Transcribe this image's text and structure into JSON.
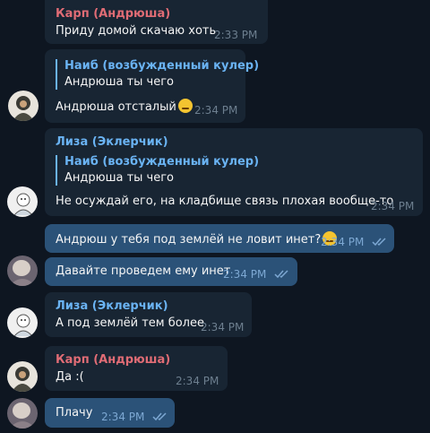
{
  "colors": {
    "background": "#0e1621",
    "incoming_bubble": "#182533",
    "outgoing_bubble": "#2b5278",
    "name_karp": "#e06c75",
    "name_liza": "#6ab3f3",
    "reply_accent": "#6ab3f3",
    "check": "#7da8d3"
  },
  "messages": [
    {
      "sender": "Карп (Андрюша)",
      "text": "Приду домой скачаю хоть",
      "time": "2:33 PM"
    },
    {
      "reply_name": "Наиб (возбужденный кулер)",
      "reply_text": "Андрюша ты чего",
      "text": "Андрюша отсталый",
      "emoji": "sad-face",
      "time": "2:34 PM"
    },
    {
      "sender": "Лиза (Эклерчик)",
      "reply_name": "Наиб (возбужденный кулер)",
      "reply_text": "Андрюша ты чего",
      "text": "Не осуждай его, на кладбище связь плохая вообще-то",
      "time": "2:34 PM"
    },
    {
      "text": "Андрюш у тебя под землёй не ловит инет?",
      "emoji": "crying-face",
      "time": "2:34 PM",
      "read": true
    },
    {
      "text": "Давайте проведем ему инет",
      "time": "2:34 PM",
      "read": true
    },
    {
      "sender": "Лиза (Эклерчик)",
      "text": "А под землёй тем более",
      "time": "2:34 PM"
    },
    {
      "sender": "Карп (Андрюша)",
      "text": "Да :(",
      "time": "2:34 PM"
    },
    {
      "text": "Плачу",
      "time": "2:34 PM",
      "read": true
    }
  ]
}
